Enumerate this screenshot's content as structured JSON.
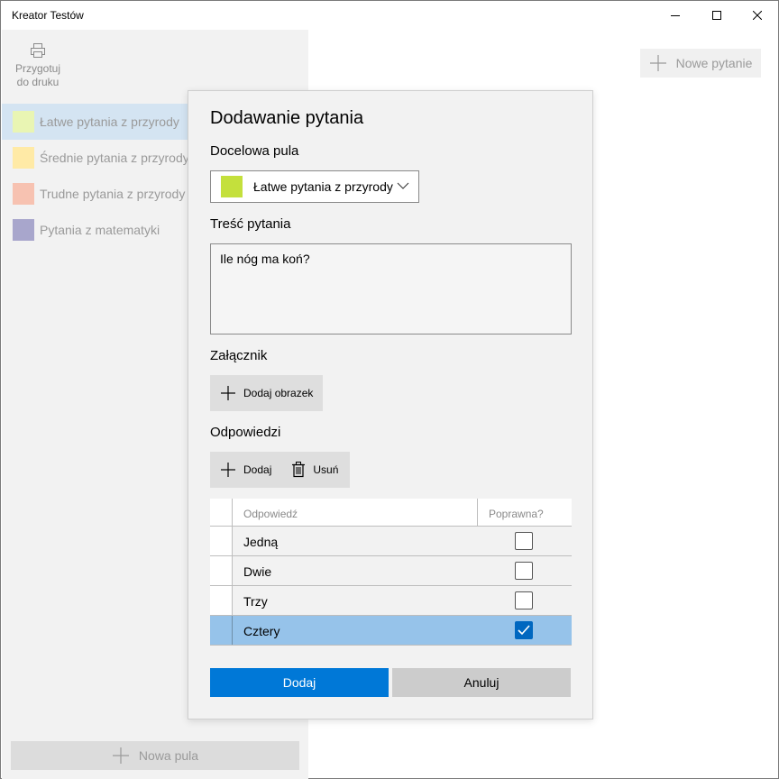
{
  "window": {
    "title": "Kreator Testów"
  },
  "sidebar": {
    "print_label_line1": "Przygotuj",
    "print_label_line2": "do druku",
    "pools": [
      {
        "label": "Łatwe pytania z przyrody",
        "color": "#e9f5b3",
        "selected": true
      },
      {
        "label": "Średnie pytania z przyrody",
        "color": "#ffeaa6",
        "selected": false
      },
      {
        "label": "Trudne pytania z przyrody",
        "color": "#f7c2b1",
        "selected": false
      },
      {
        "label": "Pytania z matematyki",
        "color": "#a8a6cc",
        "selected": false
      }
    ],
    "new_pool_label": "Nowa pula"
  },
  "toolbar": {
    "new_question_label": "Nowe pytanie"
  },
  "dialog": {
    "title": "Dodawanie pytania",
    "target_pool_label": "Docelowa pula",
    "target_pool_value": "Łatwe pytania z przyrody",
    "target_pool_color": "#c4e03c",
    "question_label": "Treść pytania",
    "question_value": "Ile nóg ma koń?",
    "attachment_label": "Załącznik",
    "add_image_label": "Dodaj obrazek",
    "answers_label": "Odpowiedzi",
    "add_answer_label": "Dodaj",
    "remove_answer_label": "Usuń",
    "grid": {
      "col_answer": "Odpowiedź",
      "col_correct": "Poprawna?",
      "rows": [
        {
          "answer": "Jedną",
          "correct": false,
          "selected": false
        },
        {
          "answer": "Dwie",
          "correct": false,
          "selected": false
        },
        {
          "answer": "Trzy",
          "correct": false,
          "selected": false
        },
        {
          "answer": "Cztery",
          "correct": true,
          "selected": true
        }
      ]
    },
    "confirm_label": "Dodaj",
    "cancel_label": "Anuluj"
  },
  "colors": {
    "accent": "#0078d7",
    "selection": "#96c3ea"
  }
}
